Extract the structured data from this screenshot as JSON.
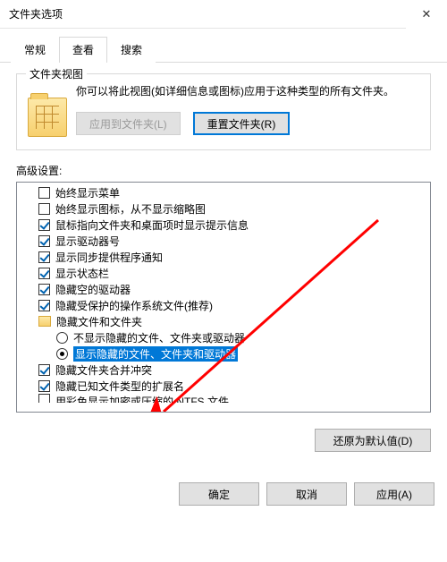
{
  "window": {
    "title": "文件夹选项"
  },
  "tabs": {
    "general": "常规",
    "view": "查看",
    "search": "搜索"
  },
  "groupbox": {
    "label": "文件夹视图",
    "desc": "你可以将此视图(如详细信息或图标)应用于这种类型的所有文件夹。",
    "apply": "应用到文件夹(L)",
    "reset": "重置文件夹(R)"
  },
  "section": "高级设置:",
  "items": {
    "i0": "始终显示菜单",
    "i1": "始终显示图标，从不显示缩略图",
    "i2": "鼠标指向文件夹和桌面项时显示提示信息",
    "i3": "显示驱动器号",
    "i4": "显示同步提供程序通知",
    "i5": "显示状态栏",
    "i6": "隐藏空的驱动器",
    "i7": "隐藏受保护的操作系统文件(推荐)",
    "i8": "隐藏文件和文件夹",
    "i8a": "不显示隐藏的文件、文件夹或驱动器",
    "i8b": "显示隐藏的文件、文件夹和驱动器",
    "i9": "隐藏文件夹合并冲突",
    "i10": "隐藏已知文件类型的扩展名",
    "i11": "用彩色显示加密或压缩的 NTFS 文件"
  },
  "restore": "还原为默认值(D)",
  "buttons": {
    "ok": "确定",
    "cancel": "取消",
    "apply": "应用(A)"
  }
}
